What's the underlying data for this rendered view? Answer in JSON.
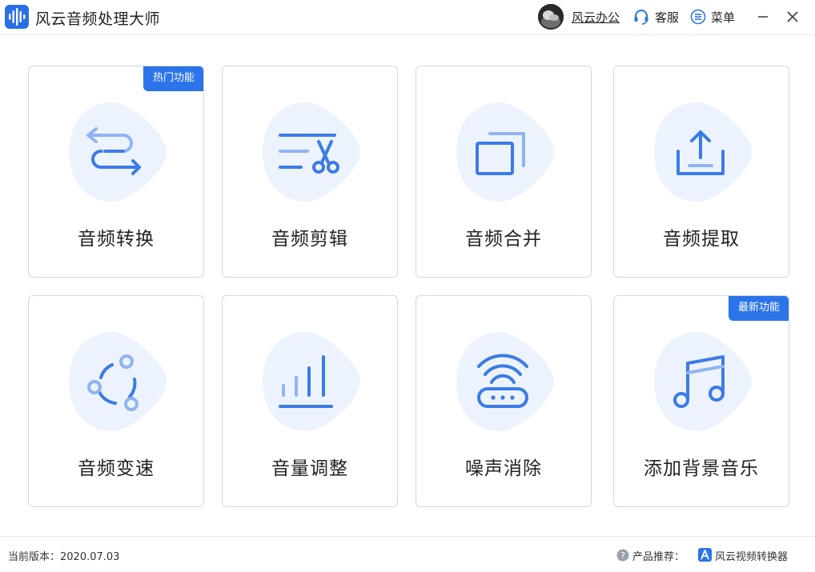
{
  "app": {
    "title": "风云音频处理大师",
    "icon": "waveform-logo-icon"
  },
  "header": {
    "user_name": "风云办公",
    "service_label": "客服",
    "menu_label": "菜单",
    "icons": [
      "avatar",
      "headset-icon",
      "menu-list-icon",
      "minimize-icon",
      "close-icon"
    ]
  },
  "colors": {
    "accent": "#2b74ea",
    "icon_dark": "#3b7be8",
    "icon_light": "#8fb4f3",
    "blob": "#edf3fd",
    "card_border": "#d4d7e2"
  },
  "features": [
    {
      "label": "音频转换",
      "icon": "convert-arrows-icon",
      "badge": "热门功能"
    },
    {
      "label": "音频剪辑",
      "icon": "scissors-icon"
    },
    {
      "label": "音频合并",
      "icon": "merge-windows-icon"
    },
    {
      "label": "音频提取",
      "icon": "export-tray-icon"
    },
    {
      "label": "音频变速",
      "icon": "speed-cycle-icon"
    },
    {
      "label": "音量调整",
      "icon": "volume-bars-icon"
    },
    {
      "label": "噪声消除",
      "icon": "noise-router-icon"
    },
    {
      "label": "添加背景音乐",
      "icon": "music-note-icon",
      "badge": "最新功能"
    }
  ],
  "footer": {
    "version": "当前版本：2020.07.03",
    "recommend_label": "产品推荐：",
    "product_name": "风云视频转换器",
    "icons": [
      "help-icon",
      "video-converter-logo-icon"
    ]
  }
}
